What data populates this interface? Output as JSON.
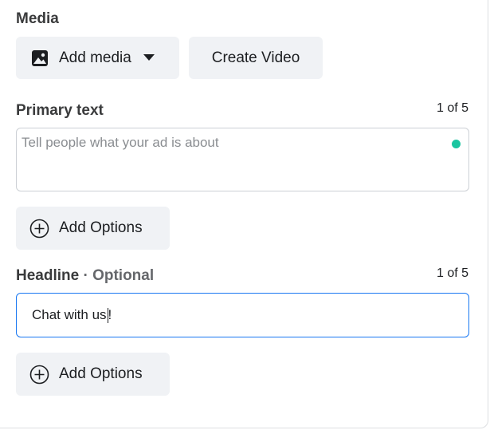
{
  "media": {
    "title": "Media",
    "add_media_label": "Add media",
    "create_video_label": "Create Video"
  },
  "primary_text": {
    "title": "Primary text",
    "counter": "1 of 5",
    "placeholder": "Tell people what your ad is about",
    "value": "",
    "add_options_label": "Add Options"
  },
  "headline": {
    "title": "Headline",
    "optional_suffix": "· Optional",
    "counter": "1 of 5",
    "value_before_caret": "Chat with us",
    "value_after_caret": "!",
    "add_options_label": "Add Options"
  },
  "colors": {
    "button_bg": "#f0f2f5",
    "focus_border": "#1877f2",
    "status_dot": "#1bc5a0"
  },
  "icons": [
    "image-icon",
    "caret-down-icon",
    "add-circle-icon"
  ]
}
